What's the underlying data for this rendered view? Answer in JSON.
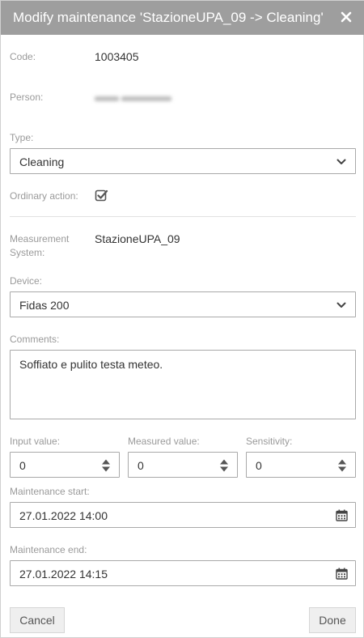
{
  "title": "Modify maintenance 'StazioneUPA_09 -> Cleaning'",
  "code": {
    "label": "Code:",
    "value": "1003405"
  },
  "person": {
    "label": "Person:"
  },
  "type": {
    "label": "Type:",
    "value": "Cleaning"
  },
  "ordinary_action": {
    "label": "Ordinary action:",
    "checked": true
  },
  "measurement_system": {
    "label_line1": "Measurement",
    "label_line2": "System:",
    "value": "StazioneUPA_09"
  },
  "device": {
    "label": "Device:",
    "value": "Fidas 200"
  },
  "comments": {
    "label": "Comments:",
    "value": "Soffiato e pulito testa meteo."
  },
  "input_value": {
    "label": "Input value:",
    "value": "0"
  },
  "measured_value": {
    "label": "Measured value:",
    "value": "0"
  },
  "sensitivity": {
    "label": "Sensitivity:",
    "value": "0"
  },
  "maintenance_start": {
    "label": "Maintenance start:",
    "value": "27.01.2022 14:00"
  },
  "maintenance_end": {
    "label": "Maintenance end:",
    "value": "27.01.2022 14:15"
  },
  "buttons": {
    "cancel": "Cancel",
    "done": "Done"
  },
  "icons": {
    "close": "close-icon",
    "chevron": "chevron-down-icon",
    "check": "checkbox-checked-icon",
    "spinner": "spinner-arrows-icon",
    "calendar": "calendar-icon"
  },
  "colors": {
    "titlebar": "#9e9e9e",
    "label": "#9a9a9a",
    "border": "#a9a9a9"
  }
}
